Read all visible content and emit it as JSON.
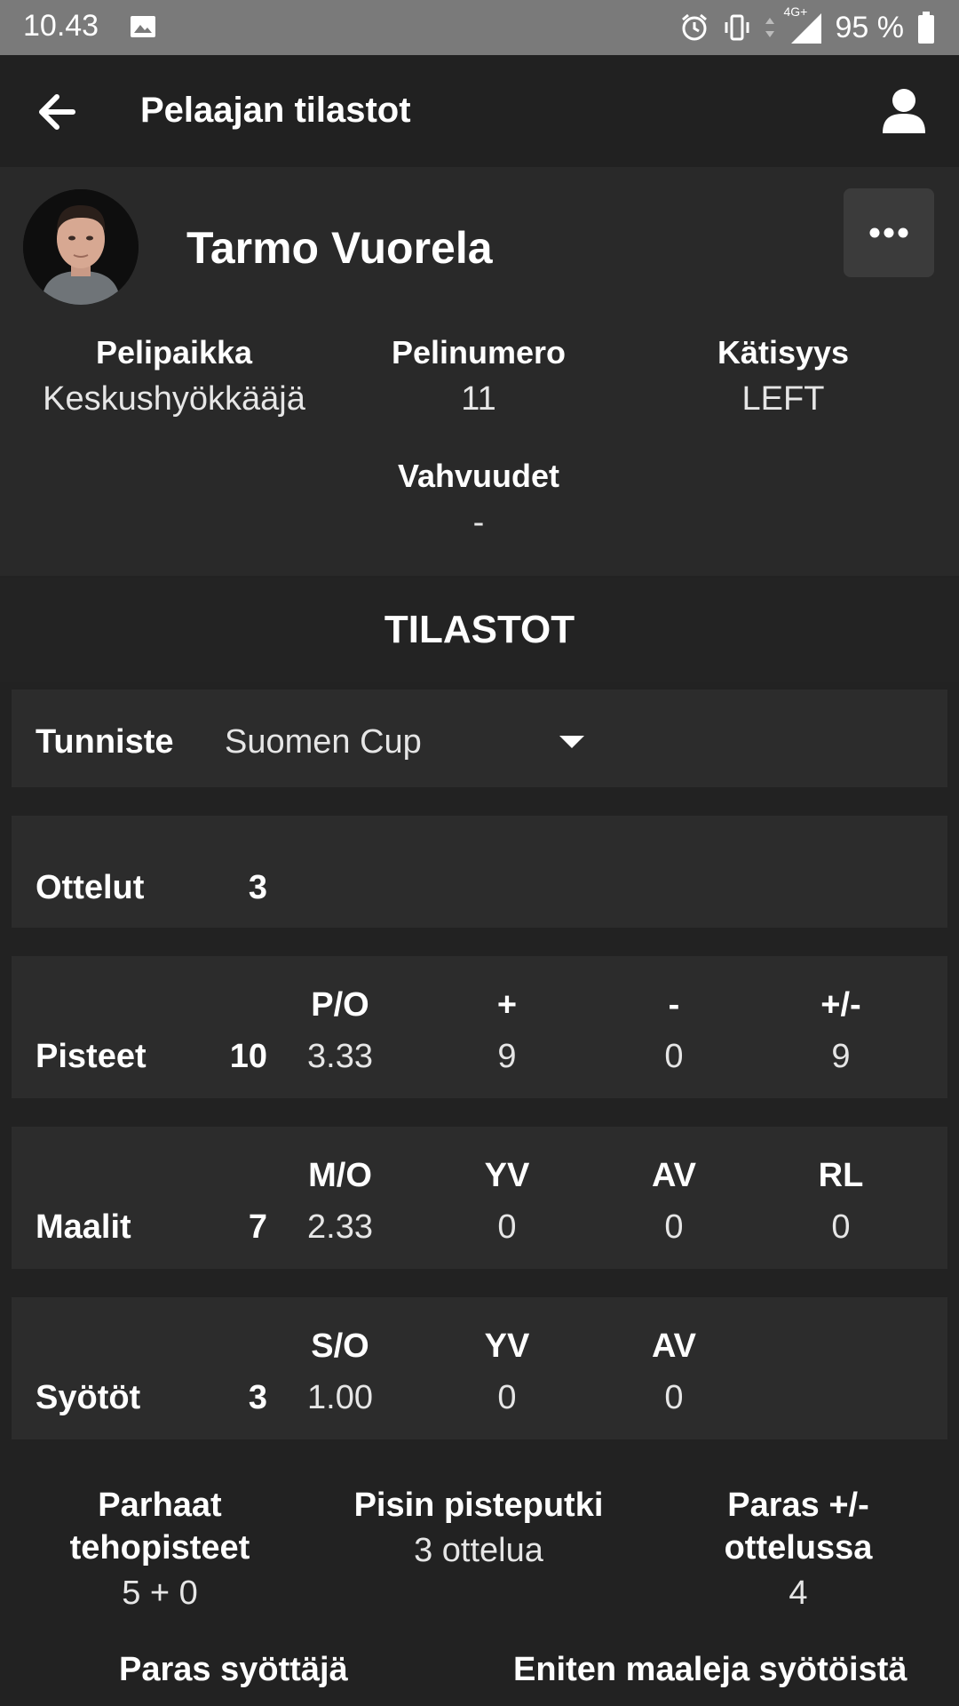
{
  "status_bar": {
    "time": "10.43",
    "battery": "95 %",
    "network": "4G+"
  },
  "app_bar": {
    "title": "Pelaajan tilastot"
  },
  "player": {
    "name": "Tarmo Vuorela",
    "info": [
      {
        "label": "Pelipaikka",
        "value": "Keskushyökkääjä"
      },
      {
        "label": "Pelinumero",
        "value": "11"
      },
      {
        "label": "Kätisyys",
        "value": "LEFT"
      }
    ],
    "strengths": {
      "label": "Vahvuudet",
      "value": "-"
    }
  },
  "stats": {
    "section_title": "TILASTOT",
    "tag": {
      "label": "Tunniste",
      "value": "Suomen Cup"
    },
    "games": {
      "label": "Ottelut",
      "value": "3"
    },
    "points": {
      "label": "Pisteet",
      "total": "10",
      "columns": [
        {
          "head": "P/O",
          "value": "3.33"
        },
        {
          "head": "+",
          "value": "9"
        },
        {
          "head": "-",
          "value": "0"
        },
        {
          "head": "+/-",
          "value": "9"
        }
      ]
    },
    "goals": {
      "label": "Maalit",
      "total": "7",
      "columns": [
        {
          "head": "M/O",
          "value": "2.33"
        },
        {
          "head": "YV",
          "value": "0"
        },
        {
          "head": "AV",
          "value": "0"
        },
        {
          "head": "RL",
          "value": "0"
        }
      ]
    },
    "assists": {
      "label": "Syötöt",
      "total": "3",
      "columns": [
        {
          "head": "S/O",
          "value": "1.00"
        },
        {
          "head": "YV",
          "value": "0"
        },
        {
          "head": "AV",
          "value": "0"
        }
      ]
    }
  },
  "highlights": [
    {
      "label_line1": "Parhaat",
      "label_line2": "tehopisteet",
      "value": "5 + 0"
    },
    {
      "label_line1": "Pisin pisteputki",
      "label_line2": "",
      "value": "3 ottelua"
    },
    {
      "label_line1": "Paras +/-",
      "label_line2": "ottelussa",
      "value": "4"
    }
  ],
  "bottom_labels": {
    "best_passer": "Paras syöttäjä",
    "most_goals_from_passes": "Eniten maaleja syötöistä"
  }
}
